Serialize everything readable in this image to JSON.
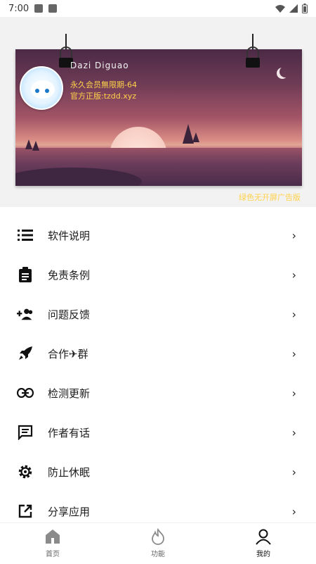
{
  "status_bar": {
    "time": "7:00"
  },
  "profile": {
    "username": "Dazi Diguao",
    "vip": "永久会员無限期-64",
    "site": "官方正版:tzdd.xyz",
    "corner_note": "绿色无开屏广告版"
  },
  "menu": {
    "items": [
      {
        "label": "软件说明",
        "icon": "list-icon"
      },
      {
        "label": "免责条例",
        "icon": "clipboard-icon"
      },
      {
        "label": "问题反馈",
        "icon": "user-add-icon"
      },
      {
        "label": "合作✈群",
        "icon": "rocket-icon"
      },
      {
        "label": "检测更新",
        "icon": "link-icon"
      },
      {
        "label": "作者有话",
        "icon": "message-icon"
      },
      {
        "label": "防止休眠",
        "icon": "gear-icon"
      },
      {
        "label": "分享应用",
        "icon": "share-icon"
      }
    ]
  },
  "bottom_nav": {
    "items": [
      {
        "label": "首页",
        "icon": "home-icon"
      },
      {
        "label": "功能",
        "icon": "flame-icon"
      },
      {
        "label": "我的",
        "icon": "profile-icon"
      }
    ]
  }
}
